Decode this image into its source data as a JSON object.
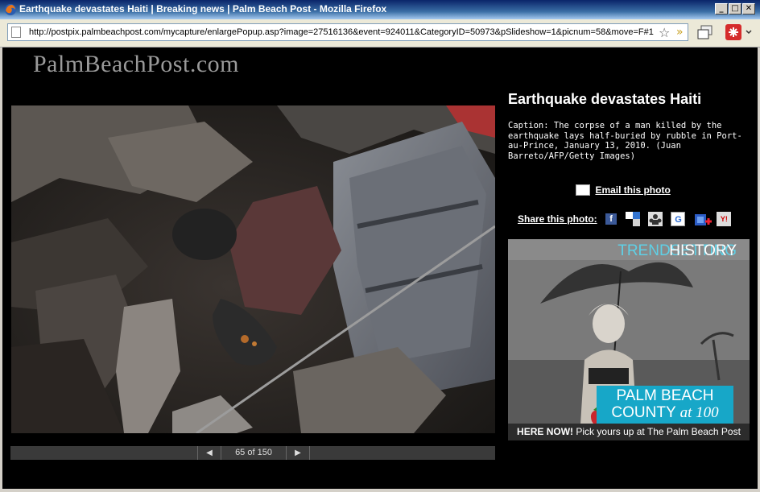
{
  "window": {
    "title": "Earthquake devastates Haiti | Breaking news | Palm Beach Post - Mozilla Firefox",
    "minimize_label": "_",
    "maximize_label": "□",
    "close_label": "✕"
  },
  "navbar": {
    "url": "http://postpix.palmbeachpost.com/mycapture/enlargePopup.asp?image=27516136&event=924011&CategoryID=50973&pSlideshow=1&picnum=58&move=F#1",
    "bookmark_icon": "☆",
    "go_icon": "»"
  },
  "page": {
    "logo": "PalmBeachPost.com",
    "headline": "Earthquake devastates Haiti",
    "caption": "Caption: The corpse of a man killed by the earthquake lays half-buried by rubble in Port-au-Prince, January 13, 2010. (Juan Barreto/AFP/Getty Images)",
    "email_label": "Email this photo",
    "share_label": "Share this photo:",
    "share_services": [
      "facebook-icon",
      "delicious-icon",
      "digg-icon",
      "google-icon",
      "yahoo-icon"
    ],
    "share_icon_glyphs": {
      "facebook": "f",
      "google": "G",
      "yahoo": "Y!"
    },
    "counter": "65 of 150",
    "prev_symbol": "◀",
    "next_symbol": "▶"
  },
  "ad": {
    "header_part1": "TRENDSETTING",
    "header_part2": "HISTORY",
    "badge_line1": "PALM BEACH",
    "badge_line2_a": "COUNTY",
    "badge_line2_b": "at 100",
    "footer_bold": "HERE NOW!",
    "footer_rest": "Pick yours up at The Palm Beach Post"
  },
  "colors": {
    "ad_accent": "#17a7c8",
    "ad_header_text": "#5fd0e6"
  }
}
